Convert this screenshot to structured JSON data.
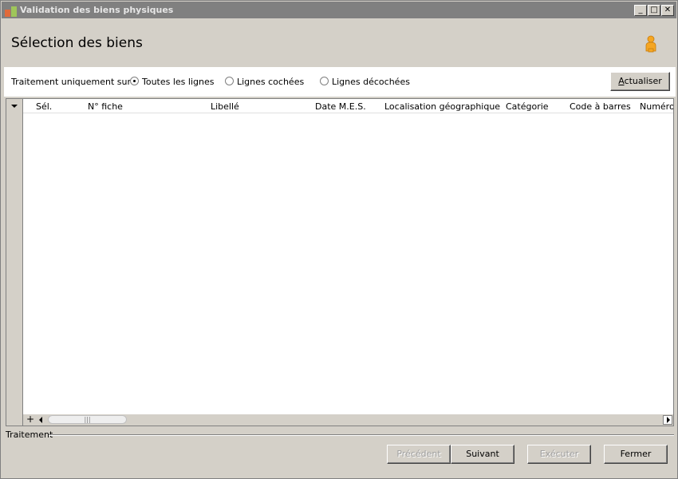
{
  "window": {
    "title": "Validation des biens physiques",
    "controls": {
      "minimize": "_",
      "maximize": "□",
      "close": "✕"
    }
  },
  "header": {
    "title": "Sélection des biens",
    "user_icon": "user-icon"
  },
  "filter": {
    "label": "Traitement uniquement sur :",
    "options": [
      {
        "label": "Toutes les lignes",
        "selected": true
      },
      {
        "label": "Lignes cochées",
        "selected": false
      },
      {
        "label": "Lignes décochées",
        "selected": false
      }
    ],
    "refresh_button": {
      "label_underlined": "A",
      "label_rest": "ctualiser"
    }
  },
  "grid": {
    "columns": [
      "Sél.",
      "N° fiche",
      "Libellé",
      "Date M.E.S.",
      "Localisation géographique",
      "Catégorie",
      "Code à barres",
      "Numéro"
    ],
    "rows": [],
    "scroll_thumb_grip": "|||",
    "add_symbol": "+"
  },
  "footer": {
    "section_label": "Traitement",
    "buttons": {
      "previous": {
        "label": "Précédent",
        "enabled": false
      },
      "next": {
        "label": "Suivant",
        "enabled": true
      },
      "execute": {
        "label": "Exécuter",
        "enabled": false
      },
      "close": {
        "label": "Fermer",
        "enabled": true
      }
    }
  },
  "colors": {
    "window_bg": "#d4d0c8",
    "titlebar_bg": "#808080",
    "content_bg": "#ffffff",
    "user_icon": "#f5a623"
  }
}
